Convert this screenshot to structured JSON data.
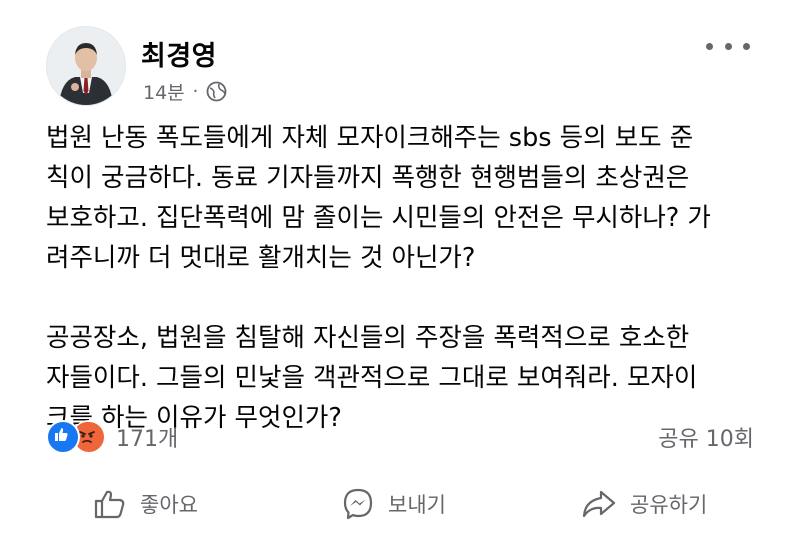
{
  "author": {
    "name": "최경영",
    "time": "14분",
    "separator": "·",
    "privacy_icon": "globe-icon"
  },
  "post": {
    "paragraphs": [
      "법원 난동 폭도들에게 자체 모자이크해주는 sbs 등의 보도 준\n칙이 궁금하다. 동료 기자들까지 폭행한 현행범들의 초상권은\n보호하고. 집단폭력에 맘 졸이는 시민들의 안전은 무시하나? 가\n려주니까 더 멋대로 활개치는 것 아닌가?",
      "공공장소, 법원을 침탈해 자신들의 주장을 폭력적으로 호소한\n자들이다. 그들의 민낯을 객관적으로 그대로 보여줘라. 모자이\n크를 하는 이유가 무엇인가?"
    ]
  },
  "reactions": {
    "icons": [
      "like-reaction-icon",
      "angry-reaction-icon"
    ],
    "count": "171개",
    "shares": "공유 10회"
  },
  "actions": {
    "like_label": "좋아요",
    "send_label": "보내기",
    "share_label": "공유하기"
  },
  "colors": {
    "like_blue": "#1877f2",
    "angry_orange": "#f0663b",
    "meta_gray": "#65676b"
  }
}
